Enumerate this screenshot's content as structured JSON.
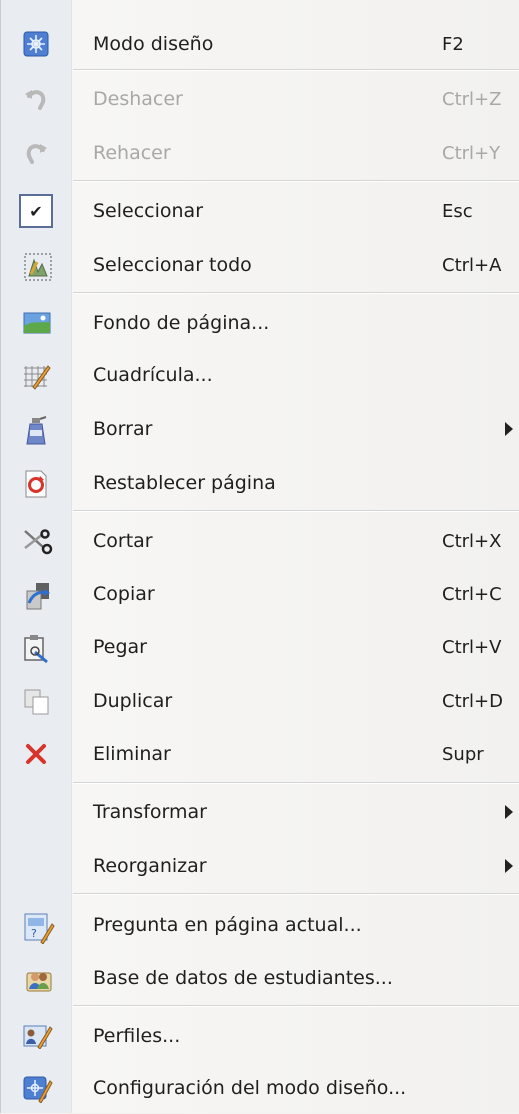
{
  "menu": {
    "items": [
      {
        "label": "Modo diseño",
        "shortcut": "F2",
        "icon": "design-mode-icon"
      },
      {
        "label": "Deshacer",
        "shortcut": "Ctrl+Z",
        "icon": "undo-icon",
        "disabled": true
      },
      {
        "label": "Rehacer",
        "shortcut": "Ctrl+Y",
        "icon": "redo-icon",
        "disabled": true
      },
      {
        "label": "Seleccionar",
        "shortcut": "Esc",
        "icon": "checkmark-icon",
        "checked": true
      },
      {
        "label": "Seleccionar todo",
        "shortcut": "Ctrl+A",
        "icon": "select-all-icon"
      },
      {
        "label": "Fondo de página...",
        "icon": "landscape-image-icon"
      },
      {
        "label": "Cuadrícula...",
        "icon": "grid-pencil-icon"
      },
      {
        "label": "Borrar",
        "icon": "eraser-spray-icon",
        "submenu": true
      },
      {
        "label": "Restablecer página",
        "icon": "refresh-page-icon"
      },
      {
        "label": "Cortar",
        "shortcut": "Ctrl+X",
        "icon": "scissors-icon"
      },
      {
        "label": "Copiar",
        "shortcut": "Ctrl+C",
        "icon": "copy-icon"
      },
      {
        "label": "Pegar",
        "shortcut": "Ctrl+V",
        "icon": "paste-icon"
      },
      {
        "label": "Duplicar",
        "shortcut": "Ctrl+D",
        "icon": "duplicate-icon"
      },
      {
        "label": "Eliminar",
        "shortcut": "Supr",
        "icon": "delete-x-icon"
      },
      {
        "label": "Transformar",
        "submenu": true
      },
      {
        "label": "Reorganizar",
        "submenu": true
      },
      {
        "label": "Pregunta en página actual...",
        "icon": "question-page-icon"
      },
      {
        "label": "Base de datos de estudiantes...",
        "icon": "student-database-icon"
      },
      {
        "label": "Perfiles...",
        "icon": "profiles-icon"
      },
      {
        "label": "Configuración del modo diseño...",
        "icon": "design-settings-icon"
      }
    ]
  },
  "colors": {
    "accent_blue": "#3b6fc4",
    "delete_red": "#d9342b",
    "disabled_text": "#a8a8a8"
  }
}
